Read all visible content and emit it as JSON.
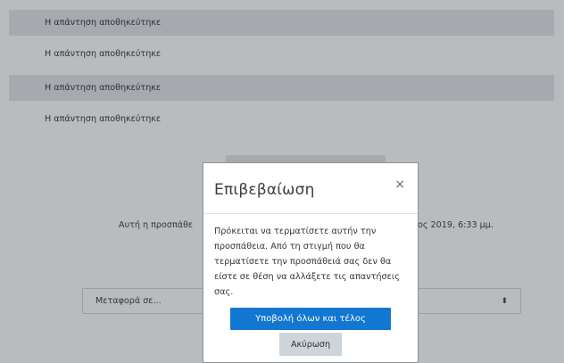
{
  "answers": [
    {
      "status": "Η απάντηση αποθηκεύτηκε"
    },
    {
      "status": "Η απάντηση αποθηκεύτηκε"
    },
    {
      "status": "Η απάντηση αποθηκεύτηκε"
    },
    {
      "status": "Η απάντηση αποθηκεύτηκε"
    }
  ],
  "notice": {
    "left_text": "Αυτή η προσπάθε",
    "right_text": "ος 2019, 6:33 μμ."
  },
  "navigation": {
    "jump_select_value": "Μεταφορά σε...",
    "dropdown_arrow": "⬍"
  },
  "modal": {
    "title": "Επιβεβαίωση",
    "close_glyph": "×",
    "body": "Πρόκειται να τερματίσετε αυτήν την προσπάθεια. Από τη στιγμή που θα τερματίσετε την προσπάθειά σας δεν θα είστε σε θέση να αλλάξετε τις απαντήσεις σας.",
    "submit_label": "Υποβολή όλων και τέλος",
    "cancel_label": "Ακύρωση"
  },
  "colors": {
    "primary": "#1177d1",
    "overlay": "#b9bcbf"
  }
}
